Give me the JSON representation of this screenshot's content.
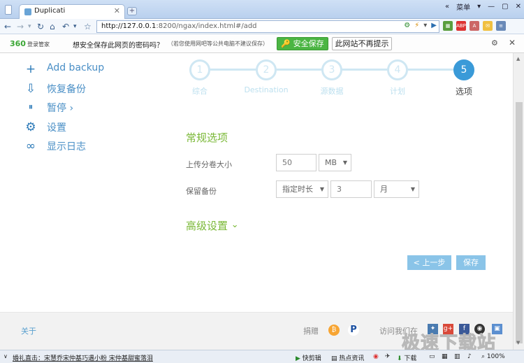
{
  "browser": {
    "tab_title": "Duplicati",
    "tab_close": "✕",
    "new_tab": "+",
    "window_menu": "菜单",
    "url_host": "http://127.0.0.1",
    "url_rest": ":8200/ngax/index.html#/add",
    "nav_icons": [
      "back-icon",
      "forward-icon",
      "refresh-icon",
      "home-icon",
      "undo-icon",
      "star-icon"
    ]
  },
  "password_bar": {
    "logo": "360",
    "logo_sub": "登录管家",
    "question": "想安全保存此网页的密码吗？",
    "hint": "（若您使用网吧等公共电脑不建议保存）",
    "save_label": "安全保存",
    "never_label": "此网站不再提示",
    "close": "✕"
  },
  "sidebar": {
    "items": [
      {
        "icon": "plus-icon",
        "glyph": "+",
        "label": "Add backup"
      },
      {
        "icon": "restore-icon",
        "glyph": "⇩",
        "label": "恢复备份"
      },
      {
        "icon": "pause-icon",
        "glyph": "⏸",
        "label": "暂停 ›"
      },
      {
        "icon": "gear-icon",
        "glyph": "⚙",
        "label": "设置"
      },
      {
        "icon": "log-icon",
        "glyph": "∞",
        "label": "显示日志"
      }
    ]
  },
  "steps": [
    {
      "number": "1",
      "label": "综合"
    },
    {
      "number": "2",
      "label": "Destination"
    },
    {
      "number": "3",
      "label": "源数据"
    },
    {
      "number": "4",
      "label": "计划"
    },
    {
      "number": "5",
      "label": "选项",
      "active": true
    }
  ],
  "general": {
    "title": "常规选项",
    "volume_label": "上传分卷大小",
    "volume_value": "50",
    "volume_unit": "MB",
    "keep_label": "保留备份",
    "keep_mode": "指定时长",
    "keep_value": "3",
    "keep_unit": "月"
  },
  "advanced": {
    "title": "高级设置",
    "chevron": "⌄"
  },
  "actions": {
    "prev": "< 上一步",
    "save": "保存"
  },
  "footer": {
    "about": "关于",
    "donate": "捐赠",
    "visit": "访问我们在"
  },
  "statusbar": {
    "news": "婚礼直击：宋慧乔宋仲基巧遇小粉 宋仲基甜蜜落泪",
    "quick_clip": "快剪辑",
    "hot_news": "热点资讯",
    "download": "下载",
    "zoom": "100%"
  },
  "watermark": "极速下载站",
  "colors": {
    "accent_blue": "#3a9ad8",
    "green_title": "#7ab836",
    "save_green": "#4bb543"
  }
}
